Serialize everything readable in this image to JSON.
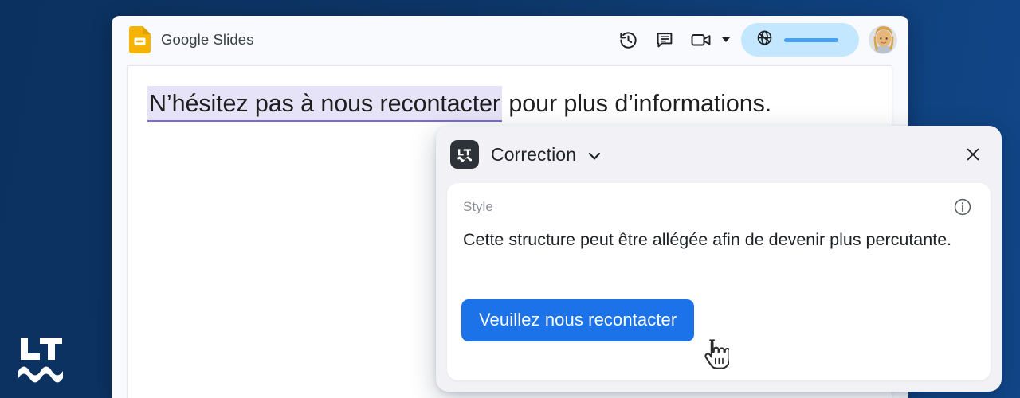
{
  "theme": {
    "background_start": "#0b3160",
    "background_end": "#114688",
    "accent_blue": "#1c72e8",
    "share_pill_bg": "#c2e7ff",
    "highlight_bg": "#e6e2f7",
    "highlight_underline": "#7b68d9",
    "popup_bg": "#f2f2f6",
    "lt_badge_bg": "#2d3238"
  },
  "watermark": {
    "name": "languagetool-logo",
    "letters": "LT"
  },
  "app": {
    "title": "Google Slides",
    "icon": "google-slides-icon",
    "toolbar": {
      "history_icon": "version-history-icon",
      "comment_icon": "comment-icon",
      "camera_icon": "video-camera-icon",
      "camera_caret_icon": "chevron-down-icon",
      "share_icon": "globe-share-icon",
      "share_label": "",
      "avatar": "user-avatar"
    }
  },
  "slide": {
    "highlighted_text": "N’hésitez pas à nous recontacter",
    "rest_text": " pour plus d’informations."
  },
  "popup": {
    "icon": "languagetool-badge-icon",
    "title": "Correction",
    "title_caret_icon": "chevron-down-icon",
    "close_icon": "close-icon",
    "category_label": "Style",
    "info_icon": "info-icon",
    "explanation": "Cette structure peut être allégée afin de devenir plus percutante.",
    "suggestion_label": "Veuillez nous recontacter"
  },
  "cursor": {
    "icon": "pointing-hand-cursor"
  }
}
